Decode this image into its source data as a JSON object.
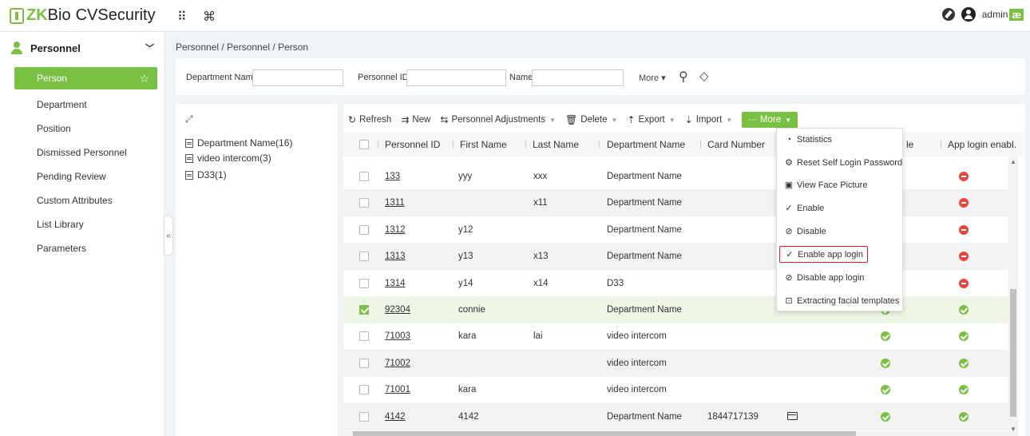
{
  "app": {
    "brand_zk": "ZK",
    "brand_bio": "Bio",
    "brand_rest": "CVSecurity",
    "grid_icon": "⠿",
    "cmd_icon": "⌘",
    "user": "admin",
    "user_badge": "æ"
  },
  "sidebar": {
    "module": "Personnel",
    "items": [
      {
        "label": "Person",
        "active": true
      },
      {
        "label": "Department"
      },
      {
        "label": "Position"
      },
      {
        "label": "Dismissed Personnel"
      },
      {
        "label": "Pending Review"
      },
      {
        "label": "Custom Attributes"
      },
      {
        "label": "List Library"
      },
      {
        "label": "Parameters"
      }
    ],
    "collapse": "«"
  },
  "breadcrumb": "Personnel / Personnel / Person",
  "filters": {
    "dept_label": "Department Name",
    "pid_label": "Personnel ID",
    "name_label": "Name",
    "more": "More ▾"
  },
  "tree": {
    "expand_icon": "⤢",
    "items": [
      "Department Name(16)",
      "video intercom(3)",
      "D33(1)"
    ]
  },
  "toolbar": {
    "refresh": "Refresh",
    "new": "New",
    "adjust": "Personnel Adjustments",
    "delete": "Delete",
    "export": "Export",
    "import": "Import",
    "more": "··· More"
  },
  "table": {
    "headers": {
      "pid": "Personnel ID",
      "first": "First Name",
      "last": "Last Name",
      "dept": "Department Name",
      "card": "Card Number",
      "col6": "le",
      "col7": "App login enabl."
    },
    "rows": [
      {
        "pid": "133",
        "first": "yyy",
        "last": "xxx",
        "dept": "Department Name",
        "card": "",
        "s1": "",
        "s2": "off"
      },
      {
        "pid": "1311",
        "first": "",
        "last": "x11",
        "dept": "Department Name",
        "card": "",
        "s1": "",
        "s2": "off"
      },
      {
        "pid": "1312",
        "first": "y12",
        "last": "",
        "dept": "Department Name",
        "card": "",
        "s1": "",
        "s2": "off"
      },
      {
        "pid": "1313",
        "first": "y13",
        "last": "x13",
        "dept": "Department Name",
        "card": "",
        "s1": "",
        "s2": "off"
      },
      {
        "pid": "1314",
        "first": "y14",
        "last": "x14",
        "dept": "D33",
        "card": "",
        "s1": "",
        "s2": "off"
      },
      {
        "pid": "92304",
        "first": "connie",
        "last": "",
        "dept": "Department Name",
        "card": "",
        "s1": "on",
        "s2": "on",
        "checked": true
      },
      {
        "pid": "71003",
        "first": "kara",
        "last": "lai",
        "dept": "video intercom",
        "card": "",
        "s1": "on",
        "s2": "on"
      },
      {
        "pid": "71002",
        "first": "",
        "last": "",
        "dept": "video intercom",
        "card": "",
        "s1": "on",
        "s2": "on"
      },
      {
        "pid": "71001",
        "first": "kara",
        "last": "",
        "dept": "video intercom",
        "card": "",
        "s1": "on",
        "s2": "on"
      },
      {
        "pid": "4142",
        "first": "4142",
        "last": "",
        "dept": "Department Name",
        "card": "1844717139",
        "s1": "on",
        "s2": "on",
        "card_icon": true
      }
    ]
  },
  "more_menu": [
    {
      "label": "Statistics",
      "icon": "◔"
    },
    {
      "label": "Reset Self Login Password",
      "icon": "⚙"
    },
    {
      "label": "View Face Picture",
      "icon": "▣"
    },
    {
      "label": "Enable",
      "icon": "✓"
    },
    {
      "label": "Disable",
      "icon": "⊘"
    },
    {
      "label": "Enable app login",
      "icon": "✓",
      "highlighted": true
    },
    {
      "label": "Disable app login",
      "icon": "⊘"
    },
    {
      "label": "Extracting facial templates",
      "icon": "⊡"
    }
  ],
  "colors": {
    "accent": "#7ac143",
    "danger": "#e8453c",
    "highlight_border": "#e02020"
  }
}
